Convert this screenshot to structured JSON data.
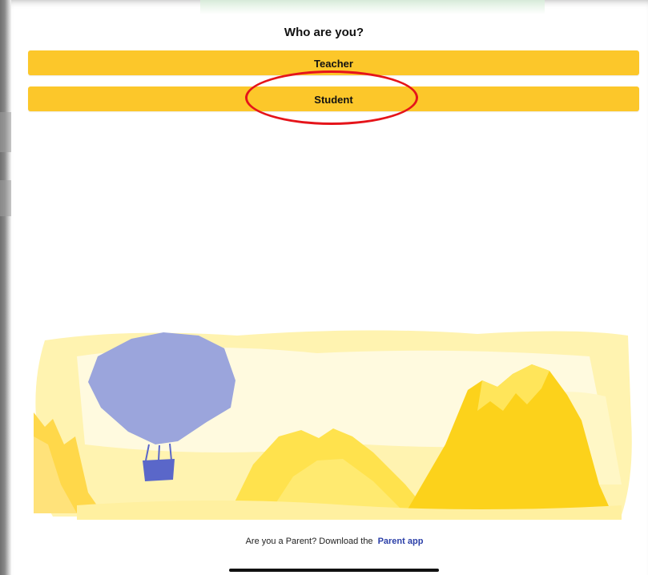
{
  "header": {
    "title": "Who are you?"
  },
  "roles": {
    "teacher_label": "Teacher",
    "student_label": "Student"
  },
  "footer": {
    "prompt": "Are you a Parent? Download the",
    "link_label": "Parent app"
  },
  "colors": {
    "button_bg": "#fcc72a",
    "link": "#2b3fa8",
    "highlight_ring": "#e5141a",
    "balloon": "#9ba5dc",
    "basket": "#5a67c9"
  },
  "annotation": {
    "highlighted_option": "Student"
  }
}
